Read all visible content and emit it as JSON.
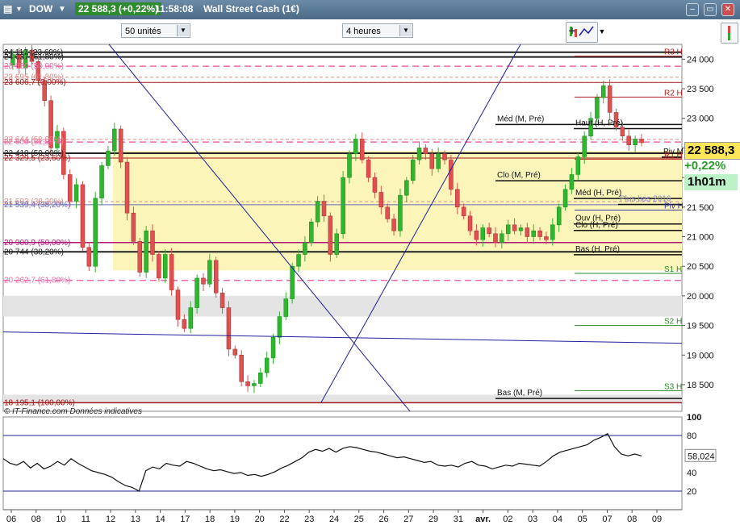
{
  "titlebar": {
    "symbol": "DOW",
    "price": "22 588,3 (+0,22%)",
    "time": "11:58:08",
    "name": "Wall Street Cash (1€)"
  },
  "toolbar": {
    "units_value": "50 unités",
    "period_value": "4 heures"
  },
  "badges": {
    "last_price": "22 588,3",
    "change": "+0,22%",
    "countdown": "1h01m"
  },
  "watermark": "© IT-Finance.com  Données indicatives",
  "colors": {
    "up": "#2fb52f",
    "down": "#e05050",
    "zone": "#fbf5b9",
    "grey_zone": "#e4e4e4",
    "trend": "#1f1f9a"
  },
  "chart_data": {
    "type": "candlestick",
    "ylim": [
      18050,
      24250
    ],
    "yticks": [
      "24 000",
      "23 500",
      "23 000",
      "22 500",
      "22 000",
      "21 500",
      "21 000",
      "20 500",
      "20 000",
      "19 500",
      "19 000",
      "18 500"
    ],
    "ytick_values": [
      24000,
      23500,
      23000,
      22500,
      22000,
      21500,
      21000,
      20500,
      20000,
      19500,
      19000,
      18500
    ],
    "xticks": [
      "06",
      "08",
      "10",
      "11",
      "12",
      "13",
      "14",
      "17",
      "18",
      "19",
      "20",
      "22",
      "23",
      "24",
      "25",
      "26",
      "27",
      "29",
      "31",
      "avr.",
      "02",
      "03",
      "04",
      "05",
      "07",
      "08",
      "09"
    ],
    "close_series": [
      23900,
      24080,
      23850,
      24150,
      23960,
      23640,
      23300,
      22500,
      22780,
      22050,
      21600,
      21880,
      20820,
      20500,
      21650,
      22200,
      22450,
      22820,
      22260,
      21400,
      20920,
      20400,
      21100,
      20700,
      20300,
      20700,
      20100,
      19600,
      19450,
      19800,
      20300,
      20200,
      20600,
      20050,
      19800,
      19100,
      19000,
      18550,
      18480,
      18520,
      18700,
      18950,
      19300,
      19650,
      19950,
      20500,
      20700,
      20900,
      21250,
      21600,
      21350,
      20700,
      21050,
      22000,
      22400,
      22650,
      22300,
      22000,
      21750,
      21500,
      21300,
      21100,
      21700,
      21950,
      22300,
      22500,
      22400,
      22150,
      22400,
      22300,
      21800,
      21500,
      21350,
      21100,
      20950,
      21150,
      21050,
      20900,
      21050,
      21200,
      21100,
      21150,
      21000,
      21100,
      21000,
      20950,
      21200,
      21500,
      21800,
      22050,
      22350,
      22700,
      23000,
      23350,
      23550,
      23100,
      22850,
      22700,
      22550,
      22650,
      22588
    ],
    "levels": [
      {
        "label": "24 117 (23,60%)",
        "value": 24117,
        "color": "#222222",
        "dash": "",
        "width": 2
      },
      {
        "label": "24 037 (61,80%)",
        "value": 24037,
        "color": "#222222",
        "dash": "",
        "width": 2
      },
      {
        "label": "23 880 (50,00%)",
        "value": 23880,
        "color": "#ef6aa6",
        "dash": "8,5",
        "width": 1.5
      },
      {
        "label": "23 695 (61,80%)",
        "value": 23695,
        "color": "#e08a8a",
        "dash": "4,3",
        "width": 1
      },
      {
        "label": "23 606,7 (0,00%)",
        "value": 23606.7,
        "color": "#a01818",
        "dash": "",
        "width": 1
      },
      {
        "label": "22 644 (50,00%)",
        "value": 22644,
        "color": "#e08a8a",
        "dash": "4,3",
        "width": 1
      },
      {
        "label": "22 600 (61,80%)",
        "value": 22600,
        "color": "#ef6aa6",
        "dash": "8,5",
        "width": 1.5
      },
      {
        "label": "22 410 (50,00%)",
        "value": 22410,
        "color": "#222222",
        "dash": "",
        "width": 2
      },
      {
        "label": "22 329,5 (23,60%)",
        "value": 22329.5,
        "color": "#a01818",
        "dash": "",
        "width": 1
      },
      {
        "label": "21 593 (38,20%)",
        "value": 21593,
        "color": "#e08a8a",
        "dash": "4,3",
        "width": 1
      },
      {
        "label": "21 539,4 (38,20%)",
        "value": 21539.4,
        "color": "#6a6ab4",
        "dash": "",
        "width": 1
      },
      {
        "label": "20 900,9 (50,00%)",
        "value": 20900.9,
        "color": "#b01878",
        "dash": "",
        "width": 1.5
      },
      {
        "label": "20 744 (38,20%)",
        "value": 20744,
        "color": "#222222",
        "dash": "",
        "width": 2
      },
      {
        "label": "20 262,7 (61,80%)",
        "value": 20262.7,
        "color": "#ef6aa6",
        "dash": "8,5",
        "width": 1.5
      },
      {
        "label": "18 195,1 (100,00%)",
        "value": 18195.1,
        "color": "#a01818",
        "dash": "",
        "width": 1.5
      }
    ],
    "pivots": [
      {
        "label": "R3 H",
        "value": 24050
      },
      {
        "label": "R2 H",
        "value": 23360
      },
      {
        "label": "R1 H",
        "value": 22310
      },
      {
        "label": "Piv H",
        "value": 21450
      },
      {
        "label": "S1 H",
        "value": 20380
      },
      {
        "label": "S2 H",
        "value": 19500
      },
      {
        "label": "S3 H",
        "value": 18400
      }
    ],
    "annotations": [
      "Méd (M, Pré)",
      "Haut (H, Pré)",
      "Piv M",
      "Clo (M, Pré)",
      "Méd (H, Pré)",
      "Plus bas 2016",
      "Ouv (H, Pré)",
      "Clo (H, Pré)",
      "Bas (H, Pré)",
      "Bas (M, Pré)"
    ],
    "oscillator": {
      "ylim": [
        0,
        100
      ],
      "yticks": [
        "100",
        "80",
        "60",
        "40",
        "20"
      ],
      "ytick_values": [
        100,
        80,
        60,
        40,
        20
      ],
      "last_value": "58,024",
      "values": [
        55,
        50,
        48,
        52,
        45,
        50,
        44,
        47,
        52,
        48,
        55,
        50,
        46,
        42,
        40,
        38,
        35,
        30,
        26,
        24,
        20,
        42,
        46,
        44,
        50,
        48,
        47,
        52,
        50,
        47,
        44,
        42,
        43,
        41,
        39,
        40,
        37,
        38,
        36,
        38,
        41,
        45,
        48,
        52,
        56,
        62,
        65,
        63,
        66,
        62,
        66,
        68,
        67,
        65,
        63,
        62,
        60,
        58,
        56,
        57,
        55,
        53,
        51,
        52,
        48,
        47,
        48,
        46,
        50,
        52,
        48,
        47,
        44,
        46,
        48,
        47,
        50,
        49,
        48,
        47,
        52,
        58,
        62,
        64,
        66,
        68,
        70,
        75,
        78,
        82,
        68,
        60,
        58,
        60,
        58
      ]
    }
  }
}
